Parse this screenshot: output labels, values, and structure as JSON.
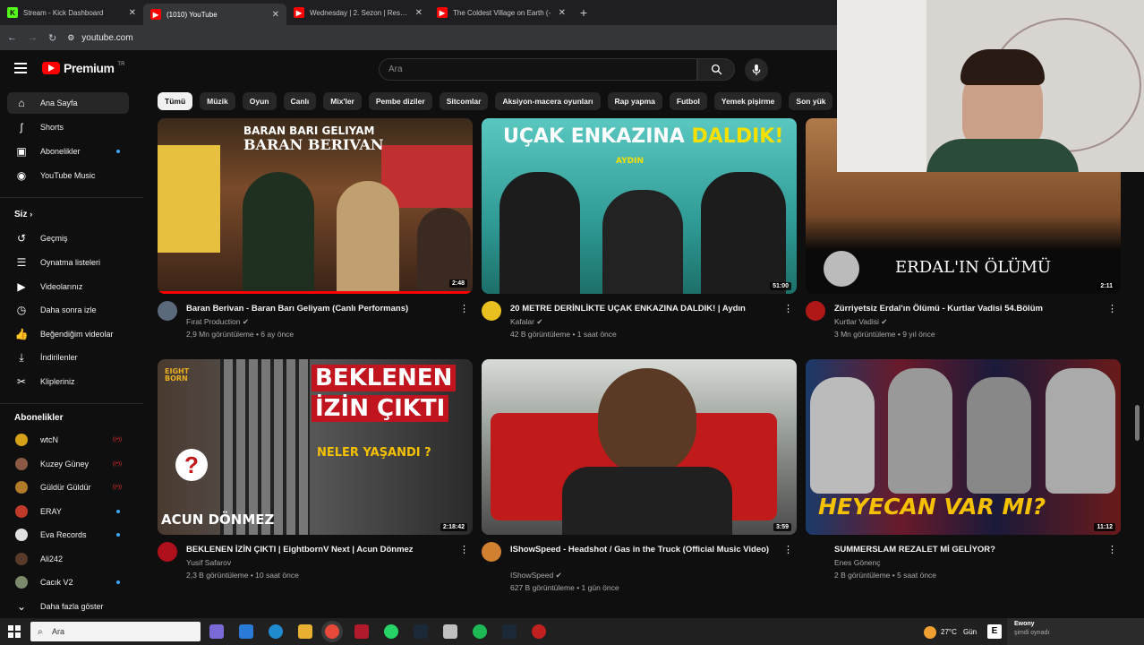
{
  "browser": {
    "tabs": [
      {
        "title": "Stream - Kick Dashboard",
        "favicon": "kick-icon",
        "color": "#53fc18"
      },
      {
        "title": "(1010) YouTube",
        "favicon": "youtube-icon",
        "color": "#ff0000"
      },
      {
        "title": "Wednesday | 2. Sezon | Resmi F",
        "favicon": "youtube-icon",
        "color": "#ff0000"
      },
      {
        "title": "The Coldest Village on Earth (-",
        "favicon": "youtube-icon",
        "color": "#ff0000"
      }
    ],
    "url": "youtube.com"
  },
  "header": {
    "logo_text": "Premium",
    "country_code": "TR",
    "search_placeholder": "Ara"
  },
  "sidebar": {
    "primary": [
      {
        "label": "Ana Sayfa",
        "icon": "home-icon",
        "active": true
      },
      {
        "label": "Shorts",
        "icon": "shorts-icon"
      },
      {
        "label": "Abonelikler",
        "icon": "subscriptions-icon",
        "dot": true
      },
      {
        "label": "YouTube Music",
        "icon": "music-icon"
      }
    ],
    "you_heading": "Siz",
    "you_items": [
      {
        "label": "Geçmiş",
        "icon": "history-icon"
      },
      {
        "label": "Oynatma listeleri",
        "icon": "playlists-icon"
      },
      {
        "label": "Videolarınız",
        "icon": "your-videos-icon"
      },
      {
        "label": "Daha sonra izle",
        "icon": "watch-later-icon"
      },
      {
        "label": "Beğendiğim videolar",
        "icon": "liked-icon"
      },
      {
        "label": "İndirilenler",
        "icon": "downloads-icon"
      },
      {
        "label": "Klipleriniz",
        "icon": "clips-icon"
      }
    ],
    "subs_heading": "Abonelikler",
    "subscriptions": [
      {
        "label": "wtcN",
        "color": "#d4a017",
        "badge": "live"
      },
      {
        "label": "Kuzey Güney",
        "color": "#8a5a44",
        "badge": "live"
      },
      {
        "label": "Güldür Güldür",
        "color": "#b07a2a",
        "badge": "live"
      },
      {
        "label": "ERAY",
        "color": "#c0392b",
        "badge": "dot"
      },
      {
        "label": "Eva Records",
        "color": "#e0e0e0",
        "badge": "dot"
      },
      {
        "label": "Ali242",
        "color": "#5a3a2a",
        "badge": ""
      },
      {
        "label": "Cacık V2",
        "color": "#7a8a6a",
        "badge": "dot"
      }
    ],
    "show_more": "Daha fazla göster"
  },
  "chips": [
    "Tümü",
    "Müzik",
    "Oyun",
    "Canlı",
    "Mix'ler",
    "Pembe diziler",
    "Sitcomlar",
    "Aksiyon-macera oyunları",
    "Rap yapma",
    "Futbol",
    "Yemek pişirme",
    "Son yük"
  ],
  "videos": [
    {
      "title": "Baran Berivan - Baran Barı Geliyam (Canlı Performans)",
      "channel": "Fırat Production",
      "stats": "2,9 Mn görüntüleme • 6 ay önce",
      "duration": "2:48",
      "thumb_top": "BARAN BARI GELIYAM",
      "thumb_main": "BARAN BERIVAN",
      "progress": 1.0,
      "bg": "#6a3a2a"
    },
    {
      "title": "20 METRE DERİNLİKTE UÇAK ENKAZINA DALDIK! | Aydın",
      "channel": "Kafalar",
      "stats": "42 B görüntüleme • 1 saat önce",
      "duration": "51:00",
      "thumb_white": "UÇAK ENKAZINA",
      "thumb_yellow": "DALDIK!",
      "thumb_sub": "AYDIN",
      "bg": "#3fa7a0"
    },
    {
      "title": "Zürriyetsiz Erdal'ın Ölümü - Kurtlar Vadisi 54.Bölüm",
      "channel": "Kurtlar Vadisi",
      "stats": "3 Mn görüntüleme • 9 yıl önce",
      "duration": "2:11",
      "thumb_text": "ERDAL'IN ÖLÜMÜ",
      "bg": "#2a1e16"
    },
    {
      "title": "BEKLENEN İZİN ÇIKTI | EightbornV Next | Acun Dönmez",
      "channel": "Yusif Safarov",
      "stats": "2,3 B görüntüleme • 10 saat önce",
      "duration": "2:18:42",
      "thumb_line1": "BEKLENEN",
      "thumb_line2": "İZİN ÇIKTI",
      "thumb_line3": "NELER YAŞANDI ?",
      "thumb_bottom": "ACUN DÖNMEZ",
      "thumb_logo": "EIGHT BORN",
      "bg": "#3a3a3a"
    },
    {
      "title": "IShowSpeed - Headshot / Gas in the Truck (Official Music Video)",
      "channel": "IShowSpeed",
      "stats": "627 B görüntüleme • 1 gün önce",
      "duration": "3:59",
      "bg": "#8a8a80"
    },
    {
      "title": "SUMMERSLAM REZALET Mİ GELİYOR?",
      "channel": "Enes Gönenç",
      "stats": "2 B görüntüleme • 5 saat önce",
      "duration": "11:12",
      "thumb_text": "HEYECAN VAR MI?",
      "bg": "#1a1a2a"
    }
  ],
  "taskbar": {
    "search_placeholder": "Ara",
    "weather": "27°C",
    "weather_trunc": "Gün",
    "notif_title": "Ewony",
    "notif_sub": "şimdi oynadı"
  }
}
